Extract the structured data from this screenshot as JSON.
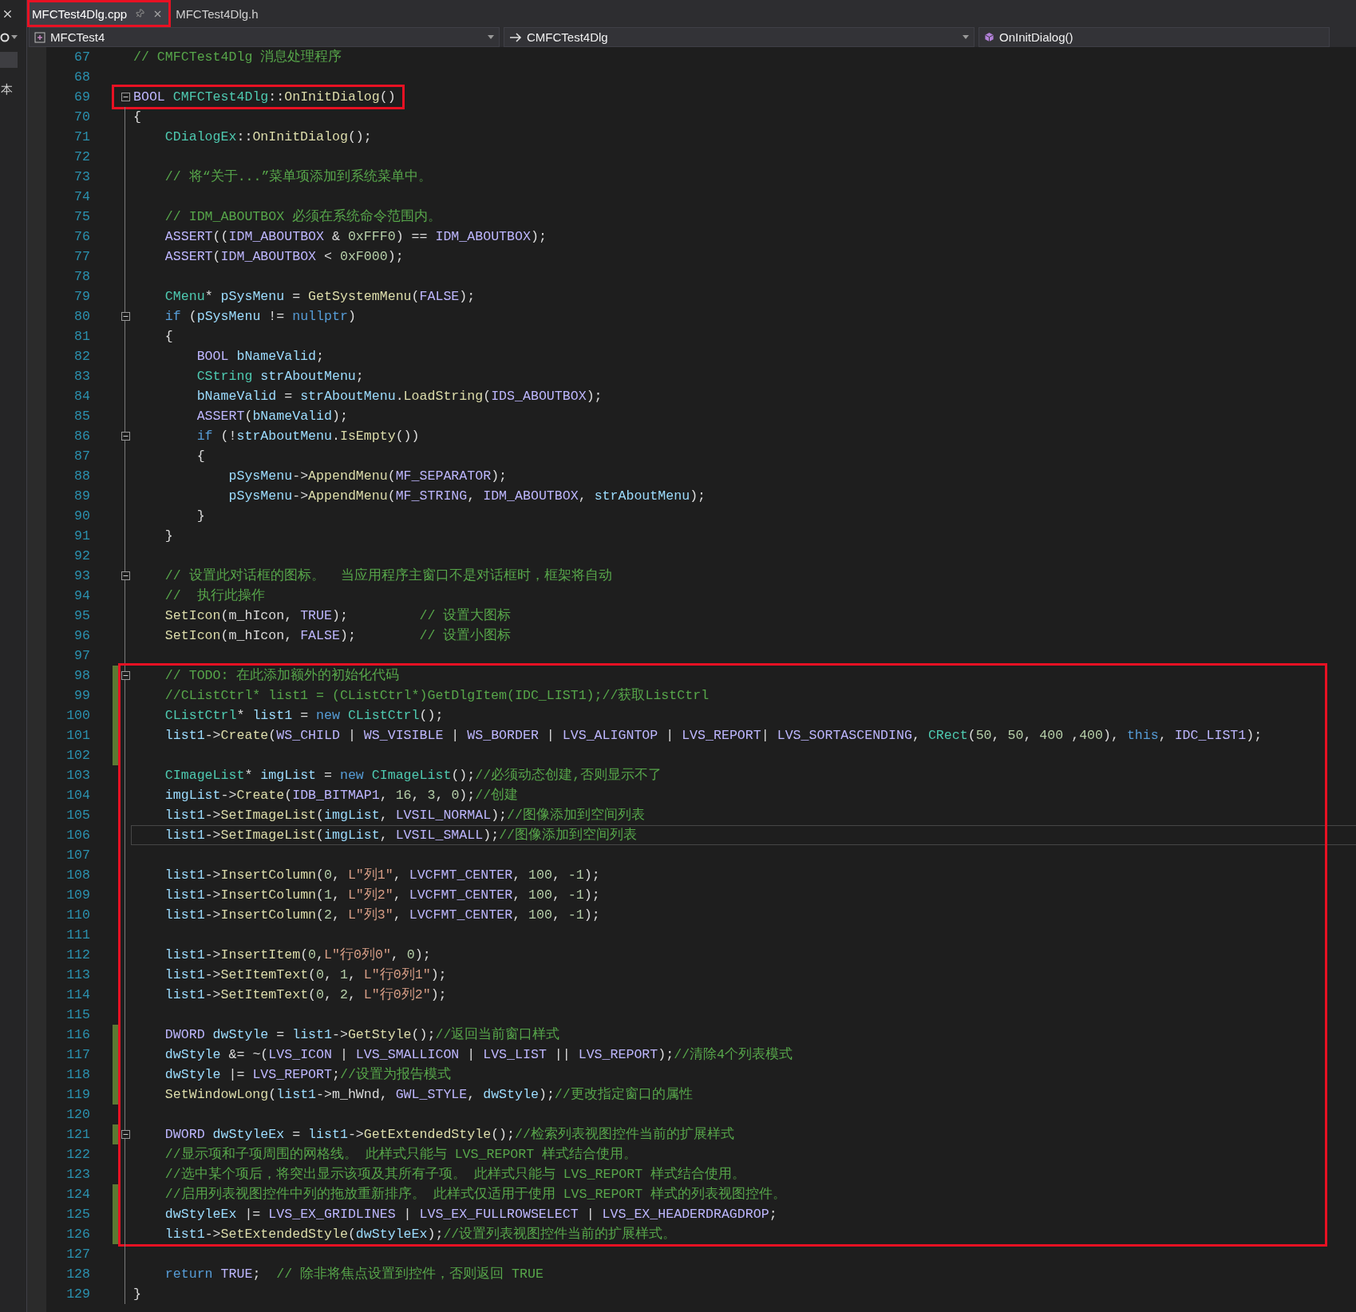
{
  "left_pane": {
    "label": "本"
  },
  "tabs": [
    {
      "label": "MFCTest4Dlg.cpp",
      "selected": true,
      "annotated": true
    },
    {
      "label": "MFCTest4Dlg.h",
      "selected": false,
      "annotated": false
    }
  ],
  "navigation": {
    "project": "MFCTest4",
    "class": "CMFCTest4Dlg",
    "member": "OnInitDialog()"
  },
  "sections": [
    {
      "annotated": false,
      "lines": [
        {
          "number": "67",
          "changed": false,
          "fold": false,
          "current": false,
          "tokens": [
            {
              "kind": "comment",
              "text": "// CMFCTest4Dlg 消息处理程序"
            }
          ]
        },
        {
          "number": "68",
          "changed": false,
          "fold": false,
          "current": false
        }
      ]
    },
    {
      "annotated": true,
      "lines": [
        {
          "number": "69",
          "changed": false,
          "fold": true,
          "current": false,
          "tokens": [
            {
              "kind": "macro",
              "text": "BOOL "
            },
            {
              "kind": "type",
              "text": "CMFCTest4Dlg"
            },
            {
              "kind": "plain",
              "text": "::"
            },
            {
              "kind": "function",
              "text": "OnInitDialog"
            },
            {
              "kind": "plain",
              "text": "()"
            }
          ]
        }
      ]
    },
    {
      "annotated": false,
      "lines": [
        {
          "number": "70",
          "changed": false,
          "fold": false,
          "current": false,
          "tokens": [
            {
              "kind": "plain",
              "text": "{"
            }
          ]
        },
        {
          "number": "71",
          "changed": false,
          "fold": false,
          "current": false,
          "tokens": [
            {
              "kind": "type",
              "text": "    CDialogEx"
            },
            {
              "kind": "plain",
              "text": "::"
            },
            {
              "kind": "function",
              "text": "OnInitDialog"
            },
            {
              "kind": "plain",
              "text": "();"
            }
          ]
        },
        {
          "number": "72",
          "changed": false,
          "fold": false,
          "current": false
        },
        {
          "number": "73",
          "changed": false,
          "fold": false,
          "current": false,
          "tokens": [
            {
              "kind": "comment",
              "text": "    // 将“关于...”菜单项添加到系统菜单中。"
            }
          ]
        },
        {
          "number": "74",
          "changed": false,
          "fold": false,
          "current": false
        },
        {
          "number": "75",
          "changed": false,
          "fold": false,
          "current": false,
          "tokens": [
            {
              "kind": "comment",
              "text": "    // IDM_ABOUTBOX 必须在系统命令范围内。"
            }
          ]
        },
        {
          "number": "76",
          "changed": false,
          "fold": false,
          "current": false,
          "tokens": [
            {
              "kind": "macro",
              "text": "    ASSERT"
            },
            {
              "kind": "plain",
              "text": "(("
            },
            {
              "kind": "macro",
              "text": "IDM_ABOUTBOX"
            },
            {
              "kind": "plain",
              "text": " & "
            },
            {
              "kind": "number",
              "text": "0xFFF0"
            },
            {
              "kind": "plain",
              "text": ") == "
            },
            {
              "kind": "macro",
              "text": "IDM_ABOUTBOX"
            },
            {
              "kind": "plain",
              "text": ");"
            }
          ]
        },
        {
          "number": "77",
          "changed": false,
          "fold": false,
          "current": false,
          "tokens": [
            {
              "kind": "macro",
              "text": "    ASSERT"
            },
            {
              "kind": "plain",
              "text": "("
            },
            {
              "kind": "macro",
              "text": "IDM_ABOUTBOX"
            },
            {
              "kind": "plain",
              "text": " < "
            },
            {
              "kind": "number",
              "text": "0xF000"
            },
            {
              "kind": "plain",
              "text": ");"
            }
          ]
        },
        {
          "number": "78",
          "changed": false,
          "fold": false,
          "current": false
        },
        {
          "number": "79",
          "changed": false,
          "fold": false,
          "current": false,
          "tokens": [
            {
              "kind": "type",
              "text": "    CMenu"
            },
            {
              "kind": "plain",
              "text": "* "
            },
            {
              "kind": "variable",
              "text": "pSysMenu"
            },
            {
              "kind": "plain",
              "text": " = "
            },
            {
              "kind": "function",
              "text": "GetSystemMenu"
            },
            {
              "kind": "plain",
              "text": "("
            },
            {
              "kind": "macro",
              "text": "FALSE"
            },
            {
              "kind": "plain",
              "text": ");"
            }
          ]
        },
        {
          "number": "80",
          "changed": false,
          "fold": true,
          "current": false,
          "tokens": [
            {
              "kind": "keyword",
              "text": "    if"
            },
            {
              "kind": "plain",
              "text": " ("
            },
            {
              "kind": "variable",
              "text": "pSysMenu"
            },
            {
              "kind": "plain",
              "text": " != "
            },
            {
              "kind": "keyword",
              "text": "nullptr"
            },
            {
              "kind": "plain",
              "text": ")"
            }
          ]
        },
        {
          "number": "81",
          "changed": false,
          "fold": false,
          "current": false,
          "tokens": [
            {
              "kind": "plain",
              "text": "    {"
            }
          ]
        },
        {
          "number": "82",
          "changed": false,
          "fold": false,
          "current": false,
          "tokens": [
            {
              "kind": "macro",
              "text": "        BOOL "
            },
            {
              "kind": "variable",
              "text": "bNameValid"
            },
            {
              "kind": "plain",
              "text": ";"
            }
          ]
        },
        {
          "number": "83",
          "changed": false,
          "fold": false,
          "current": false,
          "tokens": [
            {
              "kind": "type",
              "text": "        CString "
            },
            {
              "kind": "variable",
              "text": "strAboutMenu"
            },
            {
              "kind": "plain",
              "text": ";"
            }
          ]
        },
        {
          "number": "84",
          "changed": false,
          "fold": false,
          "current": false,
          "tokens": [
            {
              "kind": "variable",
              "text": "        bNameValid"
            },
            {
              "kind": "plain",
              "text": " = "
            },
            {
              "kind": "variable",
              "text": "strAboutMenu"
            },
            {
              "kind": "plain",
              "text": "."
            },
            {
              "kind": "function",
              "text": "LoadString"
            },
            {
              "kind": "plain",
              "text": "("
            },
            {
              "kind": "macro",
              "text": "IDS_ABOUTBOX"
            },
            {
              "kind": "plain",
              "text": ");"
            }
          ]
        },
        {
          "number": "85",
          "changed": false,
          "fold": false,
          "current": false,
          "tokens": [
            {
              "kind": "macro",
              "text": "        ASSERT"
            },
            {
              "kind": "plain",
              "text": "("
            },
            {
              "kind": "variable",
              "text": "bNameValid"
            },
            {
              "kind": "plain",
              "text": ");"
            }
          ]
        },
        {
          "number": "86",
          "changed": false,
          "fold": true,
          "current": false,
          "tokens": [
            {
              "kind": "keyword",
              "text": "        if"
            },
            {
              "kind": "plain",
              "text": " (!"
            },
            {
              "kind": "variable",
              "text": "strAboutMenu"
            },
            {
              "kind": "plain",
              "text": "."
            },
            {
              "kind": "function",
              "text": "IsEmpty"
            },
            {
              "kind": "plain",
              "text": "())"
            }
          ]
        },
        {
          "number": "87",
          "changed": false,
          "fold": false,
          "current": false,
          "tokens": [
            {
              "kind": "plain",
              "text": "        {"
            }
          ]
        },
        {
          "number": "88",
          "changed": false,
          "fold": false,
          "current": false,
          "tokens": [
            {
              "kind": "variable",
              "text": "            pSysMenu"
            },
            {
              "kind": "plain",
              "text": "->"
            },
            {
              "kind": "function",
              "text": "AppendMenu"
            },
            {
              "kind": "plain",
              "text": "("
            },
            {
              "kind": "macro",
              "text": "MF_SEPARATOR"
            },
            {
              "kind": "plain",
              "text": ");"
            }
          ]
        },
        {
          "number": "89",
          "changed": false,
          "fold": false,
          "current": false,
          "tokens": [
            {
              "kind": "variable",
              "text": "            pSysMenu"
            },
            {
              "kind": "plain",
              "text": "->"
            },
            {
              "kind": "function",
              "text": "AppendMenu"
            },
            {
              "kind": "plain",
              "text": "("
            },
            {
              "kind": "macro",
              "text": "MF_STRING"
            },
            {
              "kind": "plain",
              "text": ", "
            },
            {
              "kind": "macro",
              "text": "IDM_ABOUTBOX"
            },
            {
              "kind": "plain",
              "text": ", "
            },
            {
              "kind": "variable",
              "text": "strAboutMenu"
            },
            {
              "kind": "plain",
              "text": ");"
            }
          ]
        },
        {
          "number": "90",
          "changed": false,
          "fold": false,
          "current": false,
          "tokens": [
            {
              "kind": "plain",
              "text": "        }"
            }
          ]
        },
        {
          "number": "91",
          "changed": false,
          "fold": false,
          "current": false,
          "tokens": [
            {
              "kind": "plain",
              "text": "    }"
            }
          ]
        },
        {
          "number": "92",
          "changed": false,
          "fold": false,
          "current": false
        },
        {
          "number": "93",
          "changed": false,
          "fold": true,
          "current": false,
          "tokens": [
            {
              "kind": "comment",
              "text": "    // 设置此对话框的图标。  当应用程序主窗口不是对话框时，框架将自动"
            }
          ]
        },
        {
          "number": "94",
          "changed": false,
          "fold": false,
          "current": false,
          "tokens": [
            {
              "kind": "comment",
              "text": "    //  执行此操作"
            }
          ]
        },
        {
          "number": "95",
          "changed": false,
          "fold": false,
          "current": false,
          "tokens": [
            {
              "kind": "function",
              "text": "    SetIcon"
            },
            {
              "kind": "plain",
              "text": "("
            },
            {
              "kind": "member",
              "text": "m_hIcon"
            },
            {
              "kind": "plain",
              "text": ", "
            },
            {
              "kind": "macro",
              "text": "TRUE"
            },
            {
              "kind": "plain",
              "text": ");         "
            },
            {
              "kind": "comment",
              "text": "// 设置大图标"
            }
          ]
        },
        {
          "number": "96",
          "changed": false,
          "fold": false,
          "current": false,
          "tokens": [
            {
              "kind": "function",
              "text": "    SetIcon"
            },
            {
              "kind": "plain",
              "text": "("
            },
            {
              "kind": "member",
              "text": "m_hIcon"
            },
            {
              "kind": "plain",
              "text": ", "
            },
            {
              "kind": "macro",
              "text": "FALSE"
            },
            {
              "kind": "plain",
              "text": ");        "
            },
            {
              "kind": "comment",
              "text": "// 设置小图标"
            }
          ]
        },
        {
          "number": "97",
          "changed": false,
          "fold": false,
          "current": false
        }
      ]
    },
    {
      "annotated": true,
      "lines": [
        {
          "number": "98",
          "changed": true,
          "fold": true,
          "current": false,
          "tokens": [
            {
              "kind": "comment",
              "text": "    // TODO: 在此添加额外的初始化代码"
            }
          ]
        },
        {
          "number": "99",
          "changed": true,
          "fold": false,
          "current": false,
          "tokens": [
            {
              "kind": "comment",
              "text": "    //CListCtrl* list1 = (CListCtrl*)GetDlgItem(IDC_LIST1);//获取ListCtrl"
            }
          ]
        },
        {
          "number": "100",
          "changed": true,
          "fold": false,
          "current": false,
          "tokens": [
            {
              "kind": "type",
              "text": "    CListCtrl"
            },
            {
              "kind": "plain",
              "text": "* "
            },
            {
              "kind": "variable",
              "text": "list1"
            },
            {
              "kind": "plain",
              "text": " = "
            },
            {
              "kind": "keyword",
              "text": "new "
            },
            {
              "kind": "type",
              "text": "CListCtrl"
            },
            {
              "kind": "plain",
              "text": "();"
            }
          ]
        },
        {
          "number": "101",
          "changed": true,
          "fold": false,
          "current": false,
          "tokens": [
            {
              "kind": "variable",
              "text": "    list1"
            },
            {
              "kind": "plain",
              "text": "->"
            },
            {
              "kind": "function",
              "text": "Create"
            },
            {
              "kind": "plain",
              "text": "("
            },
            {
              "kind": "macro",
              "text": "WS_CHILD"
            },
            {
              "kind": "plain",
              "text": " | "
            },
            {
              "kind": "macro",
              "text": "WS_VISIBLE"
            },
            {
              "kind": "plain",
              "text": " | "
            },
            {
              "kind": "macro",
              "text": "WS_BORDER"
            },
            {
              "kind": "plain",
              "text": " | "
            },
            {
              "kind": "macro",
              "text": "LVS_ALIGNTOP"
            },
            {
              "kind": "plain",
              "text": " | "
            },
            {
              "kind": "macro",
              "text": "LVS_REPORT"
            },
            {
              "kind": "plain",
              "text": "| "
            },
            {
              "kind": "macro",
              "text": "LVS_SORTASCENDING"
            },
            {
              "kind": "plain",
              "text": ", "
            },
            {
              "kind": "type",
              "text": "CRect"
            },
            {
              "kind": "plain",
              "text": "("
            },
            {
              "kind": "number",
              "text": "50"
            },
            {
              "kind": "plain",
              "text": ", "
            },
            {
              "kind": "number",
              "text": "50"
            },
            {
              "kind": "plain",
              "text": ", "
            },
            {
              "kind": "number",
              "text": "400"
            },
            {
              "kind": "plain",
              "text": " ,"
            },
            {
              "kind": "number",
              "text": "400"
            },
            {
              "kind": "plain",
              "text": "), "
            },
            {
              "kind": "keyword",
              "text": "this"
            },
            {
              "kind": "plain",
              "text": ", "
            },
            {
              "kind": "macro",
              "text": "IDC_LIST1"
            },
            {
              "kind": "plain",
              "text": ");"
            }
          ]
        },
        {
          "number": "102",
          "changed": true,
          "fold": false,
          "current": false
        },
        {
          "number": "103",
          "changed": false,
          "fold": false,
          "current": false,
          "tokens": [
            {
              "kind": "type",
              "text": "    CImageList"
            },
            {
              "kind": "plain",
              "text": "* "
            },
            {
              "kind": "variable",
              "text": "imgList"
            },
            {
              "kind": "plain",
              "text": " = "
            },
            {
              "kind": "keyword",
              "text": "new "
            },
            {
              "kind": "type",
              "text": "CImageList"
            },
            {
              "kind": "plain",
              "text": "();"
            },
            {
              "kind": "comment",
              "text": "//必须动态创建,否则显示不了"
            }
          ]
        },
        {
          "number": "104",
          "changed": false,
          "fold": false,
          "current": false,
          "tokens": [
            {
              "kind": "variable",
              "text": "    imgList"
            },
            {
              "kind": "plain",
              "text": "->"
            },
            {
              "kind": "function",
              "text": "Create"
            },
            {
              "kind": "plain",
              "text": "("
            },
            {
              "kind": "macro",
              "text": "IDB_BITMAP1"
            },
            {
              "kind": "plain",
              "text": ", "
            },
            {
              "kind": "number",
              "text": "16"
            },
            {
              "kind": "plain",
              "text": ", "
            },
            {
              "kind": "number",
              "text": "3"
            },
            {
              "kind": "plain",
              "text": ", "
            },
            {
              "kind": "number",
              "text": "0"
            },
            {
              "kind": "plain",
              "text": ");"
            },
            {
              "kind": "comment",
              "text": "//创建"
            }
          ]
        },
        {
          "number": "105",
          "changed": false,
          "fold": false,
          "current": false,
          "tokens": [
            {
              "kind": "variable",
              "text": "    list1"
            },
            {
              "kind": "plain",
              "text": "->"
            },
            {
              "kind": "function",
              "text": "SetImageList"
            },
            {
              "kind": "plain",
              "text": "("
            },
            {
              "kind": "variable",
              "text": "imgList"
            },
            {
              "kind": "plain",
              "text": ", "
            },
            {
              "kind": "macro",
              "text": "LVSIL_NORMAL"
            },
            {
              "kind": "plain",
              "text": ");"
            },
            {
              "kind": "comment",
              "text": "//图像添加到空间列表"
            }
          ]
        },
        {
          "number": "106",
          "changed": false,
          "fold": false,
          "current": true,
          "tokens": [
            {
              "kind": "variable",
              "text": "    list1"
            },
            {
              "kind": "plain",
              "text": "->"
            },
            {
              "kind": "function",
              "text": "SetImageList"
            },
            {
              "kind": "plain",
              "text": "("
            },
            {
              "kind": "variable",
              "text": "imgList"
            },
            {
              "kind": "plain",
              "text": ", "
            },
            {
              "kind": "macro",
              "text": "LVSIL_SMALL"
            },
            {
              "kind": "plain",
              "text": ");"
            },
            {
              "kind": "comment",
              "text": "//图像添加到空间列表"
            }
          ]
        },
        {
          "number": "107",
          "changed": false,
          "fold": false,
          "current": false
        },
        {
          "number": "108",
          "changed": false,
          "fold": false,
          "current": false,
          "tokens": [
            {
              "kind": "variable",
              "text": "    list1"
            },
            {
              "kind": "plain",
              "text": "->"
            },
            {
              "kind": "function",
              "text": "InsertColumn"
            },
            {
              "kind": "plain",
              "text": "("
            },
            {
              "kind": "number",
              "text": "0"
            },
            {
              "kind": "plain",
              "text": ", "
            },
            {
              "kind": "string",
              "text": "L\"列1\""
            },
            {
              "kind": "plain",
              "text": ", "
            },
            {
              "kind": "macro",
              "text": "LVCFMT_CENTER"
            },
            {
              "kind": "plain",
              "text": ", "
            },
            {
              "kind": "number",
              "text": "100"
            },
            {
              "kind": "plain",
              "text": ", "
            },
            {
              "kind": "number",
              "text": "-1"
            },
            {
              "kind": "plain",
              "text": ");"
            }
          ]
        },
        {
          "number": "109",
          "changed": false,
          "fold": false,
          "current": false,
          "tokens": [
            {
              "kind": "variable",
              "text": "    list1"
            },
            {
              "kind": "plain",
              "text": "->"
            },
            {
              "kind": "function",
              "text": "InsertColumn"
            },
            {
              "kind": "plain",
              "text": "("
            },
            {
              "kind": "number",
              "text": "1"
            },
            {
              "kind": "plain",
              "text": ", "
            },
            {
              "kind": "string",
              "text": "L\"列2\""
            },
            {
              "kind": "plain",
              "text": ", "
            },
            {
              "kind": "macro",
              "text": "LVCFMT_CENTER"
            },
            {
              "kind": "plain",
              "text": ", "
            },
            {
              "kind": "number",
              "text": "100"
            },
            {
              "kind": "plain",
              "text": ", "
            },
            {
              "kind": "number",
              "text": "-1"
            },
            {
              "kind": "plain",
              "text": ");"
            }
          ]
        },
        {
          "number": "110",
          "changed": false,
          "fold": false,
          "current": false,
          "tokens": [
            {
              "kind": "variable",
              "text": "    list1"
            },
            {
              "kind": "plain",
              "text": "->"
            },
            {
              "kind": "function",
              "text": "InsertColumn"
            },
            {
              "kind": "plain",
              "text": "("
            },
            {
              "kind": "number",
              "text": "2"
            },
            {
              "kind": "plain",
              "text": ", "
            },
            {
              "kind": "string",
              "text": "L\"列3\""
            },
            {
              "kind": "plain",
              "text": ", "
            },
            {
              "kind": "macro",
              "text": "LVCFMT_CENTER"
            },
            {
              "kind": "plain",
              "text": ", "
            },
            {
              "kind": "number",
              "text": "100"
            },
            {
              "kind": "plain",
              "text": ", "
            },
            {
              "kind": "number",
              "text": "-1"
            },
            {
              "kind": "plain",
              "text": ");"
            }
          ]
        },
        {
          "number": "111",
          "changed": false,
          "fold": false,
          "current": false
        },
        {
          "number": "112",
          "changed": false,
          "fold": false,
          "current": false,
          "tokens": [
            {
              "kind": "variable",
              "text": "    list1"
            },
            {
              "kind": "plain",
              "text": "->"
            },
            {
              "kind": "function",
              "text": "InsertItem"
            },
            {
              "kind": "plain",
              "text": "("
            },
            {
              "kind": "number",
              "text": "0"
            },
            {
              "kind": "plain",
              "text": ","
            },
            {
              "kind": "string",
              "text": "L\"行0列0\""
            },
            {
              "kind": "plain",
              "text": ", "
            },
            {
              "kind": "number",
              "text": "0"
            },
            {
              "kind": "plain",
              "text": ");"
            }
          ]
        },
        {
          "number": "113",
          "changed": false,
          "fold": false,
          "current": false,
          "tokens": [
            {
              "kind": "variable",
              "text": "    list1"
            },
            {
              "kind": "plain",
              "text": "->"
            },
            {
              "kind": "function",
              "text": "SetItemText"
            },
            {
              "kind": "plain",
              "text": "("
            },
            {
              "kind": "number",
              "text": "0"
            },
            {
              "kind": "plain",
              "text": ", "
            },
            {
              "kind": "number",
              "text": "1"
            },
            {
              "kind": "plain",
              "text": ", "
            },
            {
              "kind": "string",
              "text": "L\"行0列1\""
            },
            {
              "kind": "plain",
              "text": ");"
            }
          ]
        },
        {
          "number": "114",
          "changed": false,
          "fold": false,
          "current": false,
          "tokens": [
            {
              "kind": "variable",
              "text": "    list1"
            },
            {
              "kind": "plain",
              "text": "->"
            },
            {
              "kind": "function",
              "text": "SetItemText"
            },
            {
              "kind": "plain",
              "text": "("
            },
            {
              "kind": "number",
              "text": "0"
            },
            {
              "kind": "plain",
              "text": ", "
            },
            {
              "kind": "number",
              "text": "2"
            },
            {
              "kind": "plain",
              "text": ", "
            },
            {
              "kind": "string",
              "text": "L\"行0列2\""
            },
            {
              "kind": "plain",
              "text": ");"
            }
          ]
        },
        {
          "number": "115",
          "changed": false,
          "fold": false,
          "current": false
        },
        {
          "number": "116",
          "changed": true,
          "fold": false,
          "current": false,
          "tokens": [
            {
              "kind": "macro",
              "text": "    DWORD "
            },
            {
              "kind": "variable",
              "text": "dwStyle"
            },
            {
              "kind": "plain",
              "text": " = "
            },
            {
              "kind": "variable",
              "text": "list1"
            },
            {
              "kind": "plain",
              "text": "->"
            },
            {
              "kind": "function",
              "text": "GetStyle"
            },
            {
              "kind": "plain",
              "text": "();"
            },
            {
              "kind": "comment",
              "text": "//返回当前窗口样式"
            }
          ]
        },
        {
          "number": "117",
          "changed": true,
          "fold": false,
          "current": false,
          "tokens": [
            {
              "kind": "variable",
              "text": "    dwStyle"
            },
            {
              "kind": "plain",
              "text": " &= ~("
            },
            {
              "kind": "macro",
              "text": "LVS_ICON"
            },
            {
              "kind": "plain",
              "text": " | "
            },
            {
              "kind": "macro",
              "text": "LVS_SMALLICON"
            },
            {
              "kind": "plain",
              "text": " | "
            },
            {
              "kind": "macro",
              "text": "LVS_LIST"
            },
            {
              "kind": "plain",
              "text": " || "
            },
            {
              "kind": "macro",
              "text": "LVS_REPORT"
            },
            {
              "kind": "plain",
              "text": ");"
            },
            {
              "kind": "comment",
              "text": "//清除4个列表模式"
            }
          ]
        },
        {
          "number": "118",
          "changed": true,
          "fold": false,
          "current": false,
          "tokens": [
            {
              "kind": "variable",
              "text": "    dwStyle"
            },
            {
              "kind": "plain",
              "text": " |= "
            },
            {
              "kind": "macro",
              "text": "LVS_REPORT"
            },
            {
              "kind": "plain",
              "text": ";"
            },
            {
              "kind": "comment",
              "text": "//设置为报告模式"
            }
          ]
        },
        {
          "number": "119",
          "changed": true,
          "fold": false,
          "current": false,
          "tokens": [
            {
              "kind": "function",
              "text": "    SetWindowLong"
            },
            {
              "kind": "plain",
              "text": "("
            },
            {
              "kind": "variable",
              "text": "list1"
            },
            {
              "kind": "plain",
              "text": "->"
            },
            {
              "kind": "member",
              "text": "m_hWnd"
            },
            {
              "kind": "plain",
              "text": ", "
            },
            {
              "kind": "macro",
              "text": "GWL_STYLE"
            },
            {
              "kind": "plain",
              "text": ", "
            },
            {
              "kind": "variable",
              "text": "dwStyle"
            },
            {
              "kind": "plain",
              "text": ");"
            },
            {
              "kind": "comment",
              "text": "//更改指定窗口的属性"
            }
          ]
        },
        {
          "number": "120",
          "changed": false,
          "fold": false,
          "current": false
        },
        {
          "number": "121",
          "changed": true,
          "fold": true,
          "current": false,
          "tokens": [
            {
              "kind": "macro",
              "text": "    DWORD "
            },
            {
              "kind": "variable",
              "text": "dwStyleEx"
            },
            {
              "kind": "plain",
              "text": " = "
            },
            {
              "kind": "variable",
              "text": "list1"
            },
            {
              "kind": "plain",
              "text": "->"
            },
            {
              "kind": "function",
              "text": "GetExtendedStyle"
            },
            {
              "kind": "plain",
              "text": "();"
            },
            {
              "kind": "comment",
              "text": "//检索列表视图控件当前的扩展样式"
            }
          ]
        },
        {
          "number": "122",
          "changed": false,
          "fold": false,
          "current": false,
          "tokens": [
            {
              "kind": "comment",
              "text": "    //显示项和子项周围的网格线。 此样式只能与 LVS_REPORT 样式结合使用。"
            }
          ]
        },
        {
          "number": "123",
          "changed": false,
          "fold": false,
          "current": false,
          "tokens": [
            {
              "kind": "comment",
              "text": "    //选中某个项后，将突出显示该项及其所有子项。 此样式只能与 LVS_REPORT 样式结合使用。"
            }
          ]
        },
        {
          "number": "124",
          "changed": true,
          "fold": false,
          "current": false,
          "tokens": [
            {
              "kind": "comment",
              "text": "    //启用列表视图控件中列的拖放重新排序。 此样式仅适用于使用 LVS_REPORT 样式的列表视图控件。"
            }
          ]
        },
        {
          "number": "125",
          "changed": true,
          "fold": false,
          "current": false,
          "tokens": [
            {
              "kind": "variable",
              "text": "    dwStyleEx"
            },
            {
              "kind": "plain",
              "text": " |= "
            },
            {
              "kind": "macro",
              "text": "LVS_EX_GRIDLINES"
            },
            {
              "kind": "plain",
              "text": " | "
            },
            {
              "kind": "macro",
              "text": "LVS_EX_FULLROWSELECT"
            },
            {
              "kind": "plain",
              "text": " | "
            },
            {
              "kind": "macro",
              "text": "LVS_EX_HEADERDRAGDROP"
            },
            {
              "kind": "plain",
              "text": ";"
            }
          ]
        },
        {
          "number": "126",
          "changed": true,
          "fold": false,
          "current": false,
          "tokens": [
            {
              "kind": "variable",
              "text": "    list1"
            },
            {
              "kind": "plain",
              "text": "->"
            },
            {
              "kind": "function",
              "text": "SetExtendedStyle"
            },
            {
              "kind": "plain",
              "text": "("
            },
            {
              "kind": "variable",
              "text": "dwStyleEx"
            },
            {
              "kind": "plain",
              "text": ");"
            },
            {
              "kind": "comment",
              "text": "//设置列表视图控件当前的扩展样式。"
            }
          ]
        }
      ]
    },
    {
      "annotated": false,
      "lines": [
        {
          "number": "127",
          "changed": false,
          "fold": false,
          "current": false
        },
        {
          "number": "128",
          "changed": false,
          "fold": false,
          "current": false,
          "tokens": [
            {
              "kind": "keyword",
              "text": "    return "
            },
            {
              "kind": "macro",
              "text": "TRUE"
            },
            {
              "kind": "plain",
              "text": ";  "
            },
            {
              "kind": "comment",
              "text": "// 除非将焦点设置到控件，否则返回 TRUE"
            }
          ]
        },
        {
          "number": "129",
          "changed": false,
          "fold": false,
          "current": false,
          "tokens": [
            {
              "kind": "plain",
              "text": "}"
            }
          ]
        }
      ]
    }
  ]
}
